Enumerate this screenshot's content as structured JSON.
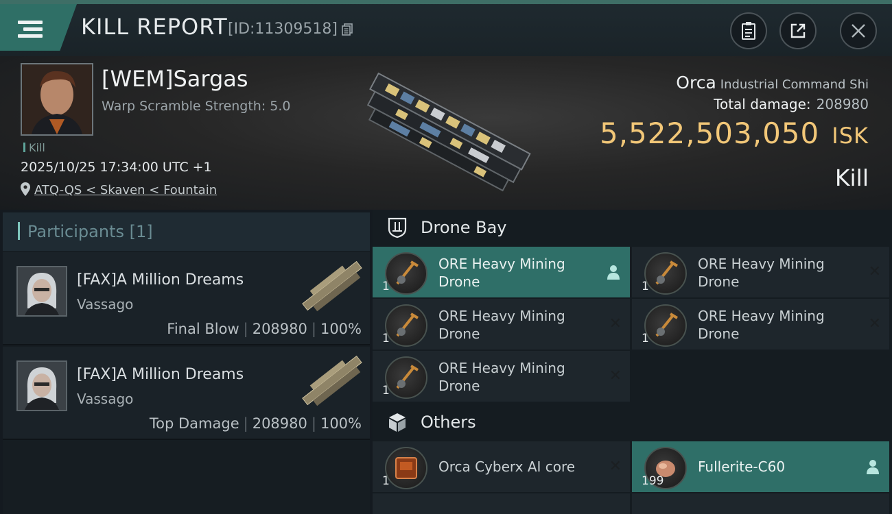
{
  "header": {
    "title": "KILL REPORT",
    "kill_id": "[ID:11309518]"
  },
  "victim": {
    "name": "[WEM]Sargas",
    "warp_scramble": "Warp Scramble Strength: 5.0",
    "tag": "Kill",
    "datetime": "2025/10/25 17:34:00 UTC +1",
    "location": "ATQ-QS < Skaven < Fountain",
    "ship_name": "Orca",
    "ship_class": "Industrial Command Shi",
    "total_damage_label": "Total damage:",
    "total_damage_value": "208980",
    "isk_value": "5,522,503,050",
    "isk_unit": "ISK",
    "result": "Kill"
  },
  "participants": {
    "title": "Participants [1]",
    "rows": [
      {
        "name": "[FAX]A Million Dreams",
        "ship": "Vassago",
        "role": "Final Blow",
        "damage": "208980",
        "percent": "100%"
      },
      {
        "name": "[FAX]A Million Dreams",
        "ship": "Vassago",
        "role": "Top Damage",
        "damage": "208980",
        "percent": "100%"
      }
    ]
  },
  "drone_bay": {
    "title": "Drone Bay",
    "items": [
      {
        "name": "ORE Heavy Mining Drone",
        "line1": "ORE Heavy Mining",
        "line2": "Drone",
        "qty": "1",
        "status": "person"
      },
      {
        "name": "ORE Heavy Mining Drone",
        "line1": "ORE Heavy Mining",
        "line2": "Drone",
        "qty": "1",
        "status": "destroyed"
      },
      {
        "name": "ORE Heavy Mining Drone",
        "line1": "ORE Heavy Mining",
        "line2": "Drone",
        "qty": "1",
        "status": "destroyed"
      },
      {
        "name": "ORE Heavy Mining Drone",
        "line1": "ORE Heavy Mining",
        "line2": "Drone",
        "qty": "1",
        "status": "destroyed"
      },
      {
        "name": "ORE Heavy Mining Drone",
        "line1": "ORE Heavy Mining",
        "line2": "Drone",
        "qty": "1",
        "status": "destroyed"
      }
    ]
  },
  "others": {
    "title": "Others",
    "items": [
      {
        "name": "Orca Cyberx AI core",
        "qty": "1",
        "status": "destroyed"
      },
      {
        "name": "Fullerite-C60",
        "qty": "199",
        "status": "person"
      }
    ]
  },
  "colors": {
    "accent": "#2f6f68",
    "isk": "#f2c778",
    "background": "#151c21"
  },
  "icons": [
    "menu-icon",
    "copy-icon",
    "clipboard-icon",
    "share-icon",
    "close-icon",
    "location-pin-icon",
    "drone-bay-icon",
    "cube-icon",
    "person-icon",
    "x-icon"
  ]
}
